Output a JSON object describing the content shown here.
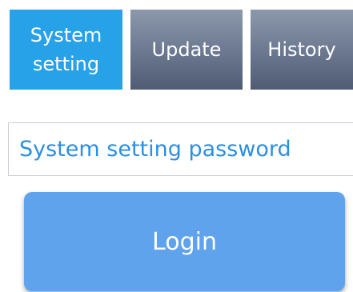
{
  "tabs": {
    "system_setting": {
      "line1": "System",
      "line2": "setting",
      "active": true
    },
    "update": {
      "label": "Update"
    },
    "history": {
      "label": "History"
    }
  },
  "password": {
    "placeholder": "System setting password",
    "value": ""
  },
  "login": {
    "label": "Login"
  },
  "colors": {
    "active_tab": "#27a2e8",
    "inactive_tab": "#707d94",
    "field_text": "#2d8fe0",
    "login_button": "#5fa3ec"
  }
}
